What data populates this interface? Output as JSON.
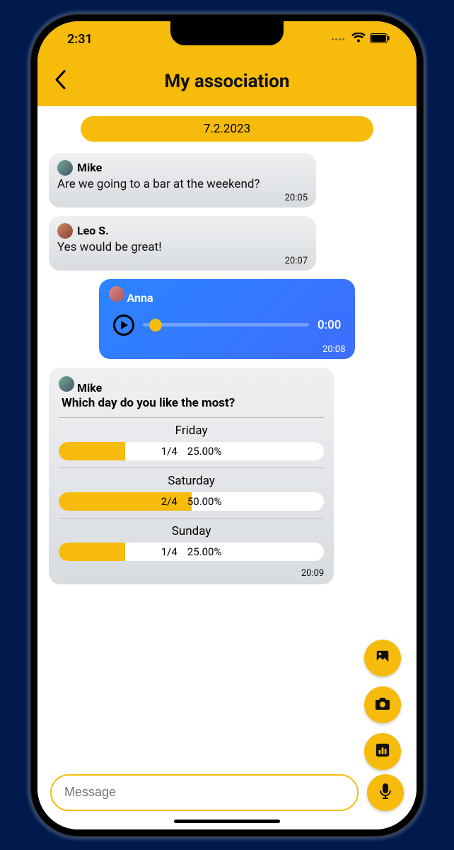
{
  "status": {
    "time": "2:31"
  },
  "header": {
    "title": "My association"
  },
  "date_pill": "7.2.2023",
  "messages": {
    "m1": {
      "sender": "Mike",
      "text": "Are we going to a bar at the weekend?",
      "time": "20:05"
    },
    "m2": {
      "sender": "Leo S.",
      "text": "Yes would be great!",
      "time": "20:07"
    },
    "m3": {
      "sender": "Anna",
      "duration": "0:00",
      "time": "20:08"
    }
  },
  "poll": {
    "sender": "Mike",
    "question": "Which day do you like the most?",
    "options": [
      {
        "label": "Friday",
        "count": "1/4",
        "pct": "25.00%",
        "fill": 25
      },
      {
        "label": "Saturday",
        "count": "2/4",
        "pct": "50.00%",
        "fill": 50
      },
      {
        "label": "Sunday",
        "count": "1/4",
        "pct": "25.00%",
        "fill": 25
      }
    ],
    "time": "20:09"
  },
  "composer": {
    "placeholder": "Message"
  }
}
